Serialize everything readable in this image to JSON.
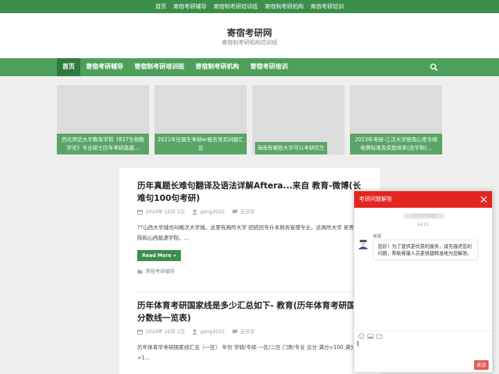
{
  "topbar": {
    "links": [
      "首页",
      "寄宿考研辅导",
      "寄宿制考研培训班",
      "寄宿制考研机构",
      "寄宿考研培训"
    ]
  },
  "header": {
    "title": "寄宿考研网",
    "description": "寄宿制考研机构培训班"
  },
  "nav": {
    "items": [
      "首页",
      "寄宿考研辅导",
      "寄宿制考研培训班",
      "寄宿制考研机构",
      "寄宿考研培训"
    ],
    "search_icon": "search-icon"
  },
  "slides": [
    {
      "caption": "西北师范大学教育学院《837生物教学论》专业硕士历年考研真题..."
    },
    {
      "caption": "2021年往届生考研er报名常见问题汇总"
    },
    {
      "caption": "海南有哪些大学可以考研究生"
    },
    {
      "caption": "2023年考研-江汉大学使用心思专硕收费标准及奖助体系(含学制)..."
    }
  ],
  "posts": [
    {
      "title": "历年真题长难句翻译及语法详解Aftera...来自 教育-微博(长难句100句考研)",
      "date": "2024年 10月 2日",
      "author": "gong2022",
      "comments": "无评论",
      "excerpt": "??山西大学城也叫榆次大学城，这里有两所大学 招统招专升本财务管理专业。这两所大学 是晋中学院和山西能源学院。...",
      "more": "Read More »",
      "category": "寄宿考研辅导"
    },
    {
      "title": "历年体育考研国家线是多少汇总如下- 教育(历年体育考研国家分数线一览表)",
      "date": "2024年 10月 2日",
      "author": "gong2022",
      "comments": "无评论",
      "excerpt": "历年体育学考研国家线汇总（一区） 年份 学硕/专硕 一区/二区 门类/专业 总分 满分=100 满分>1..."
    }
  ],
  "chat": {
    "title": "考研问题解答",
    "pill": "以下为历史消息",
    "time": "14:21",
    "agent": "客服",
    "message": "您好！为了提供更优质的服务，请先描述您的问题，帮助客服人员更快捷精准地为您解答。",
    "send": "发送",
    "accent": "#e52520"
  }
}
